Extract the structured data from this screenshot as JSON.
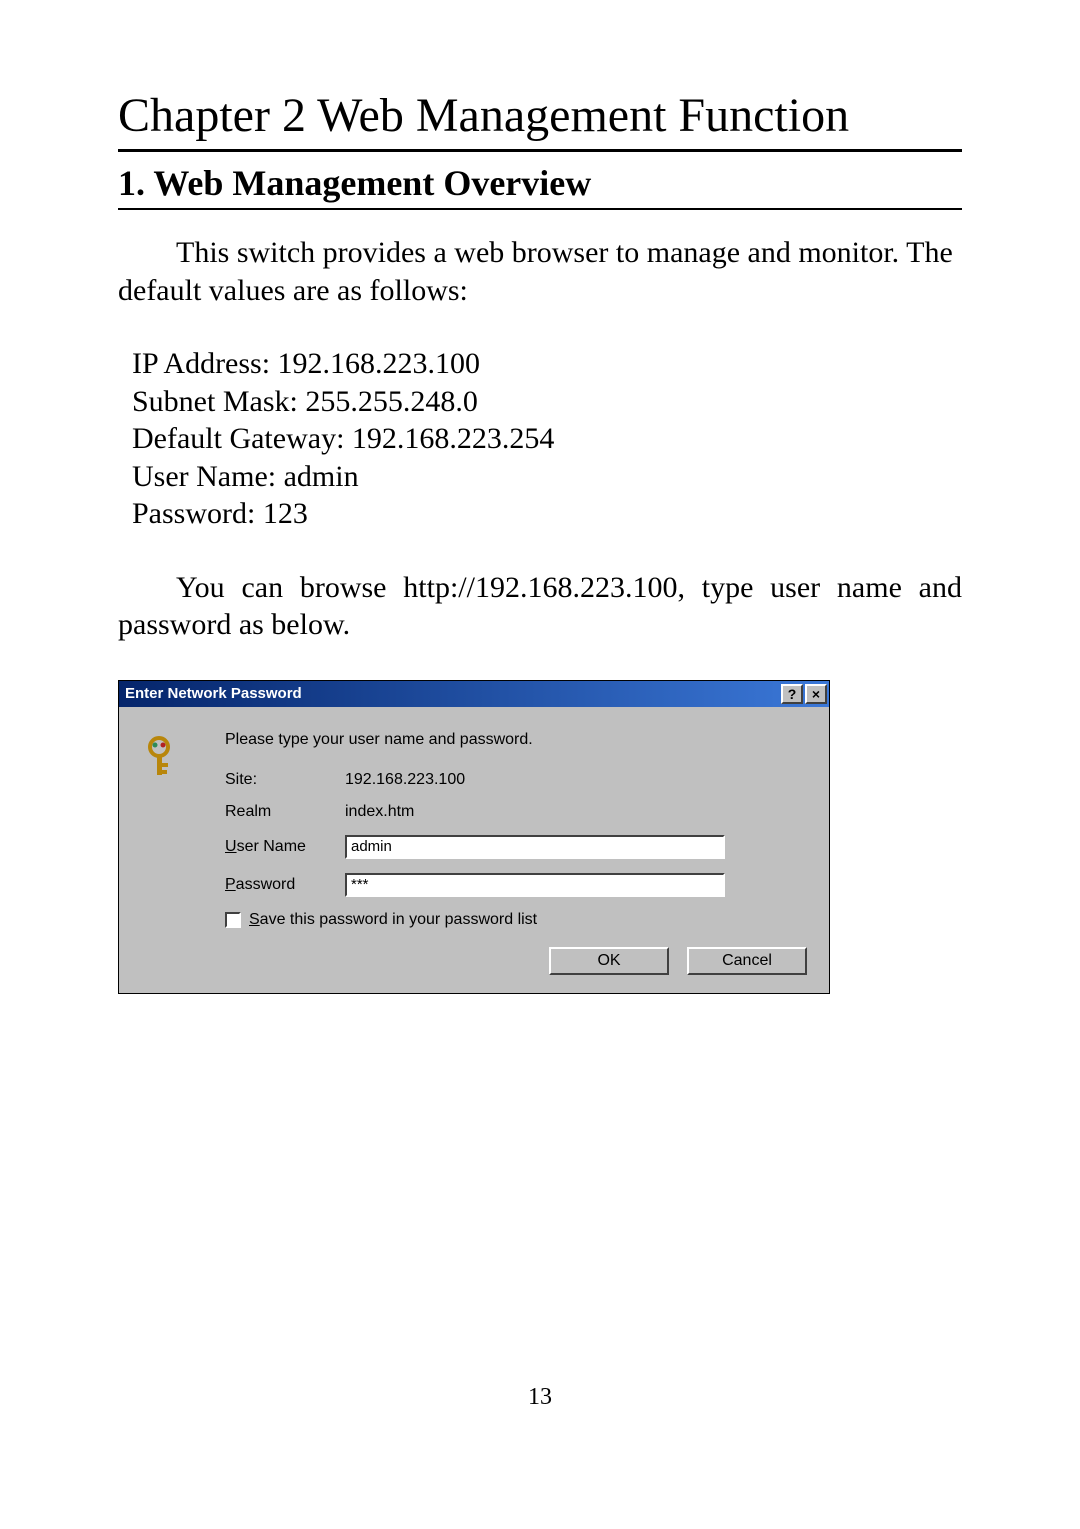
{
  "chapter_title": "Chapter 2 Web Management Function",
  "section_title": "1. Web Management Overview",
  "intro": "This switch provides a web browser to manage and monitor. The default values are as follows:",
  "defaults": {
    "ip": "IP Address: 192.168.223.100",
    "subnet": "Subnet Mask: 255.255.248.0",
    "gateway": "Default Gateway: 192.168.223.254",
    "user": "User Name: admin",
    "password": "Password: 123"
  },
  "instruction": "You can browse http://192.168.223.100, type user name and password as below.",
  "dialog": {
    "title": "Enter Network Password",
    "help_glyph": "?",
    "close_glyph": "×",
    "prompt": "Please type your user name and password.",
    "site_label": "Site:",
    "site_value": "192.168.223.100",
    "realm_label": "Realm",
    "realm_value": "index.htm",
    "user_label_prefix": "U",
    "user_label_rest": "ser Name",
    "user_value": "admin",
    "pass_label_prefix": "P",
    "pass_label_rest": "assword",
    "pass_value": "***",
    "save_prefix": "S",
    "save_rest": "ave this password in your password list",
    "ok": "OK",
    "cancel": "Cancel"
  },
  "page_number": "13"
}
